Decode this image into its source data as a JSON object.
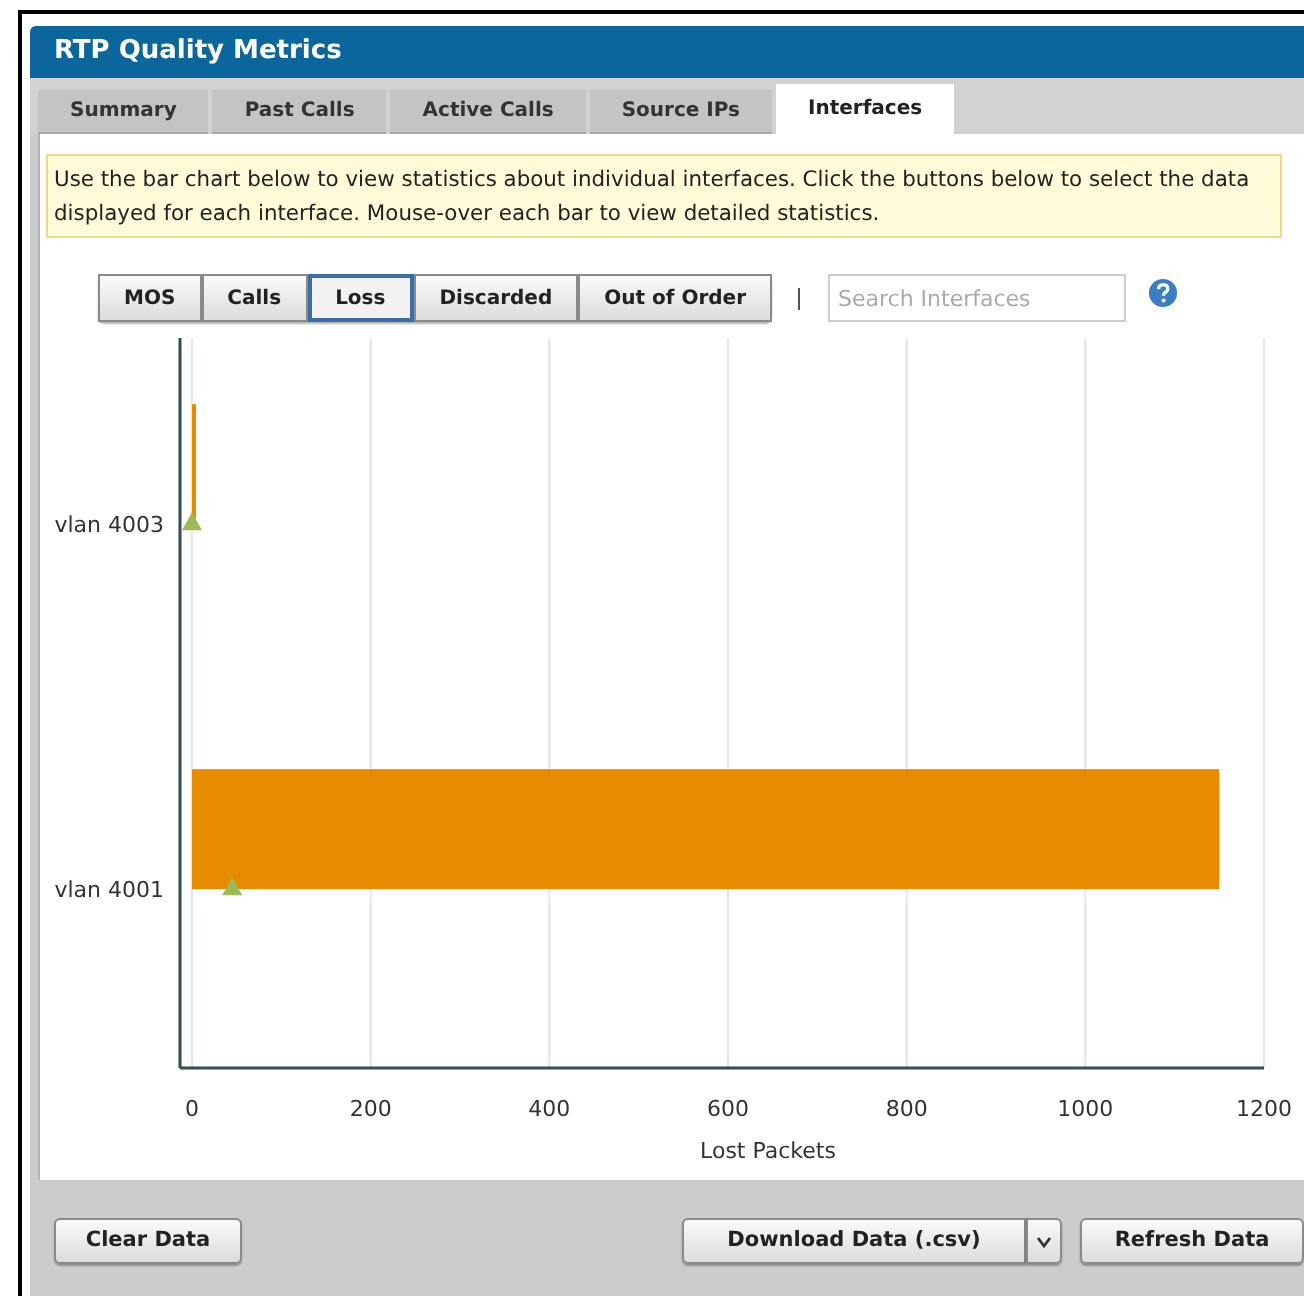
{
  "window": {
    "title": "RTP Quality Metrics"
  },
  "tabs": [
    {
      "label": "Summary",
      "selected": false
    },
    {
      "label": "Past Calls",
      "selected": false
    },
    {
      "label": "Active Calls",
      "selected": false
    },
    {
      "label": "Source IPs",
      "selected": false
    },
    {
      "label": "Interfaces",
      "selected": true
    }
  ],
  "info": "Use the bar chart below to view statistics about individual interfaces. Click the buttons below to select the data displayed for each interface. Mouse-over each bar to view detailed statistics.",
  "metric_buttons": [
    {
      "label": "MOS",
      "selected": false
    },
    {
      "label": "Calls",
      "selected": false
    },
    {
      "label": "Loss",
      "selected": true
    },
    {
      "label": "Discarded",
      "selected": false
    },
    {
      "label": "Out of Order",
      "selected": false
    }
  ],
  "search": {
    "placeholder": "Search Interfaces"
  },
  "chart": {
    "chart_data": {
      "type": "bar",
      "orientation": "horizontal",
      "grid": true,
      "xlabel": "Lost Packets",
      "categories": [
        "vlan 4003",
        "vlan 4001"
      ],
      "xlim": [
        0,
        1200
      ],
      "xticks": [
        0,
        200,
        400,
        600,
        800,
        1000,
        1200
      ],
      "series": [
        {
          "color": "#e68a00",
          "values": [
            2,
            1150
          ]
        },
        {
          "type": "scatter",
          "color": "#9bbb59",
          "values": [
            0,
            45
          ]
        }
      ]
    }
  },
  "footer_buttons": {
    "clear": "Clear Data",
    "download": "Download Data (.csv)",
    "refresh": "Refresh Data"
  }
}
